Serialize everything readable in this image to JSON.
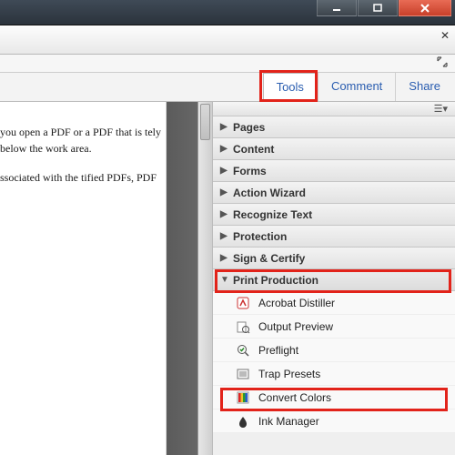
{
  "window": {
    "minimize": "–",
    "maximize": "❐",
    "close": "✕"
  },
  "tabs": {
    "tools": "Tools",
    "comment": "Comment",
    "share": "Share"
  },
  "document": {
    "p1": "you open a PDF or a PDF that is tely below the work area.",
    "p2": "ssociated with the tified PDFs, PDF"
  },
  "panel": {
    "sections": {
      "pages": "Pages",
      "content": "Content",
      "forms": "Forms",
      "action_wizard": "Action Wizard",
      "recognize_text": "Recognize Text",
      "protection": "Protection",
      "sign_certify": "Sign & Certify",
      "print_production": "Print Production"
    },
    "print_production_items": {
      "acrobat_distiller": "Acrobat Distiller",
      "output_preview": "Output Preview",
      "preflight": "Preflight",
      "trap_presets": "Trap Presets",
      "convert_colors": "Convert Colors",
      "ink_manager": "Ink Manager"
    }
  }
}
